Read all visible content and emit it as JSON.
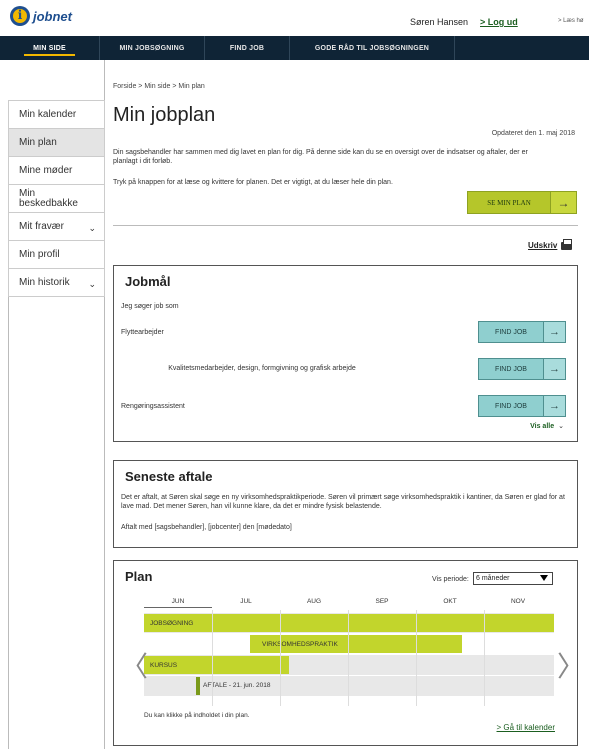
{
  "topbar": {
    "logo_text": "jobnet",
    "user_name": "Søren Hansen",
    "logout_label": "> Log ud",
    "read_aloud_label": "> Læs hø"
  },
  "mainnav": {
    "tabs": [
      {
        "label": "MIN SIDE",
        "active": true
      },
      {
        "label": "MIN JOBSØGNING",
        "active": false
      },
      {
        "label": "FIND JOB",
        "active": false
      },
      {
        "label": "GODE RÅD TIL JOBSØGNINGEN",
        "active": false
      }
    ]
  },
  "sidenav": {
    "items": [
      {
        "label": "Min kalender",
        "active": false
      },
      {
        "label": "Min plan",
        "active": true
      },
      {
        "label": "Mine møder",
        "active": false
      },
      {
        "label": "Min beskedbakke",
        "active": false
      },
      {
        "label": "Mit fravær",
        "active": false,
        "expandable": true
      },
      {
        "label": "Min profil",
        "active": false
      },
      {
        "label": "Min historik",
        "active": false,
        "expandable": true
      }
    ]
  },
  "breadcrumb": "Forside > Min side > Min plan",
  "page_title": "Min jobplan",
  "updated": "Opdateret den 1. maj 2018",
  "intro": {
    "text1": "Din sagsbehandler har sammen med dig lavet en plan for dig. På denne side kan du se en oversigt over de indsatser og aftaler, der er planlagt i dit forløb.",
    "text2": "Tryk på knappen for at læse og kvittere for planen. Det er vigtigt, at du læser hele din plan.",
    "button_label": "SE MIN PLAN"
  },
  "print_label": "Udskriv",
  "jobgoals": {
    "title": "Jobmål",
    "subtitle": "Jeg søger job som",
    "jobs": [
      {
        "label": "Flyttearbejder",
        "button": "FIND JOB"
      },
      {
        "label": "Kvalitetsmedarbejder, design, formgivning og grafisk arbejde",
        "button": "FIND JOB"
      },
      {
        "label": "Rengøringsassistent",
        "button": "FIND JOB"
      }
    ],
    "show_all": "Vis alle"
  },
  "appointment": {
    "title": "Seneste aftale",
    "text": "Det er aftalt, at Søren skal søge en ny virksomhedspraktikperiode. Søren vil primært søge virksomhedspraktik i kantiner, da Søren er glad for at lave mad. Det mener Søren, han vil kunne klare, da det er mindre fysisk belastende.",
    "meta": "Aftalt med [sagsbehandler], [jobcenter] den [mødedato]"
  },
  "plan": {
    "title": "Plan",
    "period_label": "Vis periode:",
    "period_value": "6 måneder",
    "months": [
      "JUN",
      "JUL",
      "AUG",
      "SEP",
      "OKT",
      "NOV"
    ],
    "bars": [
      {
        "label": "JOBSØGNING"
      },
      {
        "label": "VIRKSOMHEDSPRAKTIK"
      },
      {
        "label": "KURSUS"
      }
    ],
    "appointment_label": "AFTALE - 21. jun. 2018",
    "note": "Du kan klikke på indholdet i din plan.",
    "calendar_link": "> Gå til kalender"
  }
}
